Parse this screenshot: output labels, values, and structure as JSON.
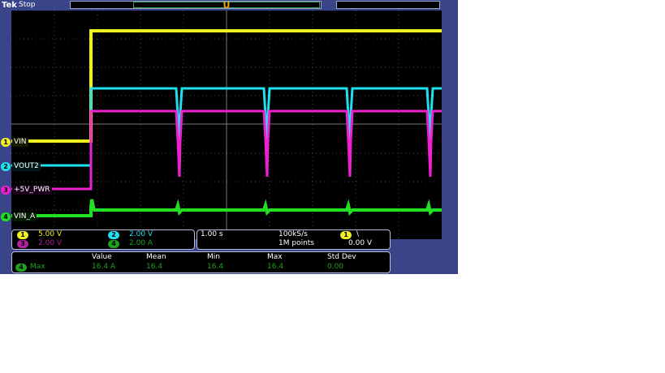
{
  "header": {
    "brand": "Tek",
    "state": "Stop",
    "trigger_glyph": "U"
  },
  "channels": [
    {
      "num": "1",
      "name": "VIN",
      "color": "#f0f020"
    },
    {
      "num": "2",
      "name": "VOUT2",
      "color": "#20e0f0"
    },
    {
      "num": "3",
      "name": "+5V_PWR",
      "color": "#f020d0"
    },
    {
      "num": "4",
      "name": "VIN_A",
      "color": "#20e020"
    }
  ],
  "scales": {
    "ch1": "5.00 V",
    "ch2": "2.00 V",
    "ch3": "2.00 V",
    "ch4": "2.00 A"
  },
  "timebase": {
    "time_div": "1.00 s",
    "sample_rate": "100kS/s",
    "record_length": "1M points",
    "trigger_channel": "1",
    "trigger_slope": "\\",
    "trigger_level": "0.00 V"
  },
  "measurements": {
    "headers": [
      "Value",
      "Mean",
      "Min",
      "Max",
      "Std Dev"
    ],
    "row": {
      "channel": "4",
      "type": "Max",
      "value": "16.4 A",
      "mean": "16.4",
      "min": "16.4",
      "max": "16.4",
      "std_dev": "0.00"
    }
  },
  "colors": {
    "background": "#3a4488",
    "grid": "#5a5a5a",
    "measurement_text": "#20a020"
  }
}
